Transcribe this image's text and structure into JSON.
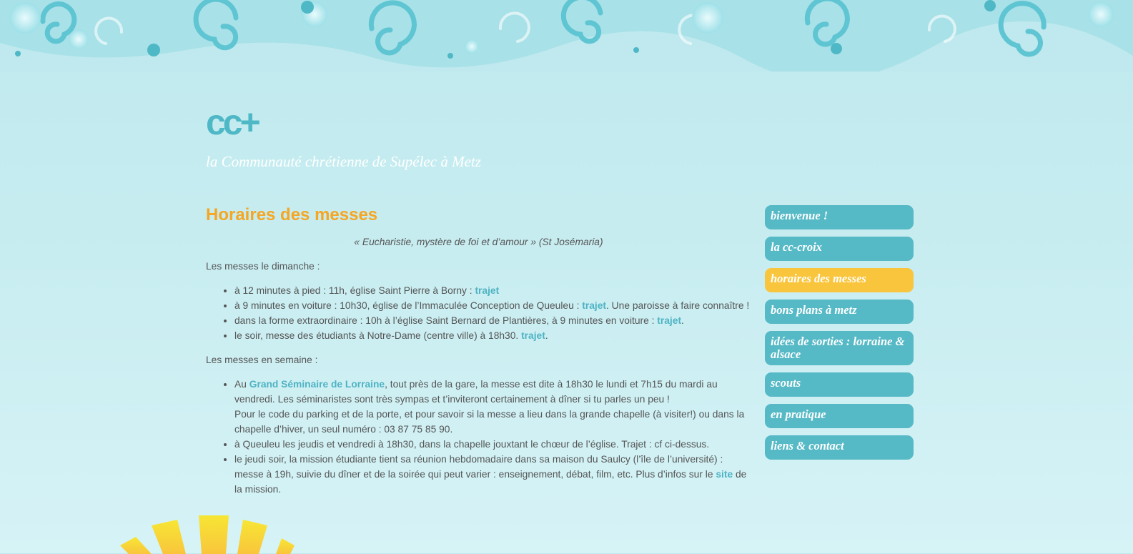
{
  "header": {
    "logo": "cc+",
    "tagline": "la Communauté chrétienne de Supélec à Metz"
  },
  "main": {
    "title": "Horaires des messes",
    "quote": "« Eucharistie, mystère de foi et d’amour » (St Josémaria)",
    "sunday_intro": "Les messes le dimanche :",
    "sunday": [
      {
        "text": "à 12 minutes à pied : 11h, église Saint Pierre à Borny : ",
        "link": "trajet",
        "after": ""
      },
      {
        "text": "à 9 minutes en voiture : 10h30, église de l’Immaculée Conception de Queuleu  : ",
        "link": "trajet",
        "after": ". Une paroisse à faire connaître !"
      },
      {
        "text": "dans la forme extraordinaire : 10h à l’église Saint Bernard de Plantières, à 9 minutes en voiture : ",
        "link": "trajet",
        "after": "."
      },
      {
        "text": "le soir, messe des étudiants à Notre-Dame (centre ville) à 18h30. ",
        "link": "trajet",
        "after": "."
      }
    ],
    "week_intro": "Les messes en semaine :",
    "week": {
      "item1_before": "Au ",
      "item1_link": "Grand Séminaire de Lorraine",
      "item1_after": ", tout près de la gare, la messe est dite à 18h30 le lundi et 7h15 du mardi au vendredi. Les séminaristes sont très sympas et t’inviteront certainement à dîner si tu parles un peu !",
      "item1_line2": "Pour le code du parking et de la porte, et pour savoir si la messe a lieu dans la grande chapelle (à visiter!)  ou dans la chapelle d’hiver, un seul numéro : 03 87 75 85 90.",
      "item2": "à Queuleu les jeudis et vendredi à 18h30, dans la chapelle jouxtant le chœur de l’église. Trajet : cf ci-dessus.",
      "item3_before": "le jeudi soir, la mission étudiante tient sa réunion hebdomadaire dans sa maison du Saulcy (l’île de l’université) : messe à 19h, suivie du dîner et de la soirée qui peut varier : enseignement, débat, film, etc. Plus d’infos sur le ",
      "item3_link": "site",
      "item3_after": " de la mission."
    }
  },
  "nav": {
    "items": [
      "bienvenue !",
      "la cc-croix",
      "horaires des messes",
      "bons plans à metz",
      "idées de sorties : lorraine & alsace",
      "scouts",
      "en pratique",
      "liens & contact"
    ],
    "active_index": 2
  },
  "colors": {
    "accent": "#55b9c6",
    "active": "#f9c53c",
    "title": "#f5a623",
    "link": "#4fb3c3"
  }
}
